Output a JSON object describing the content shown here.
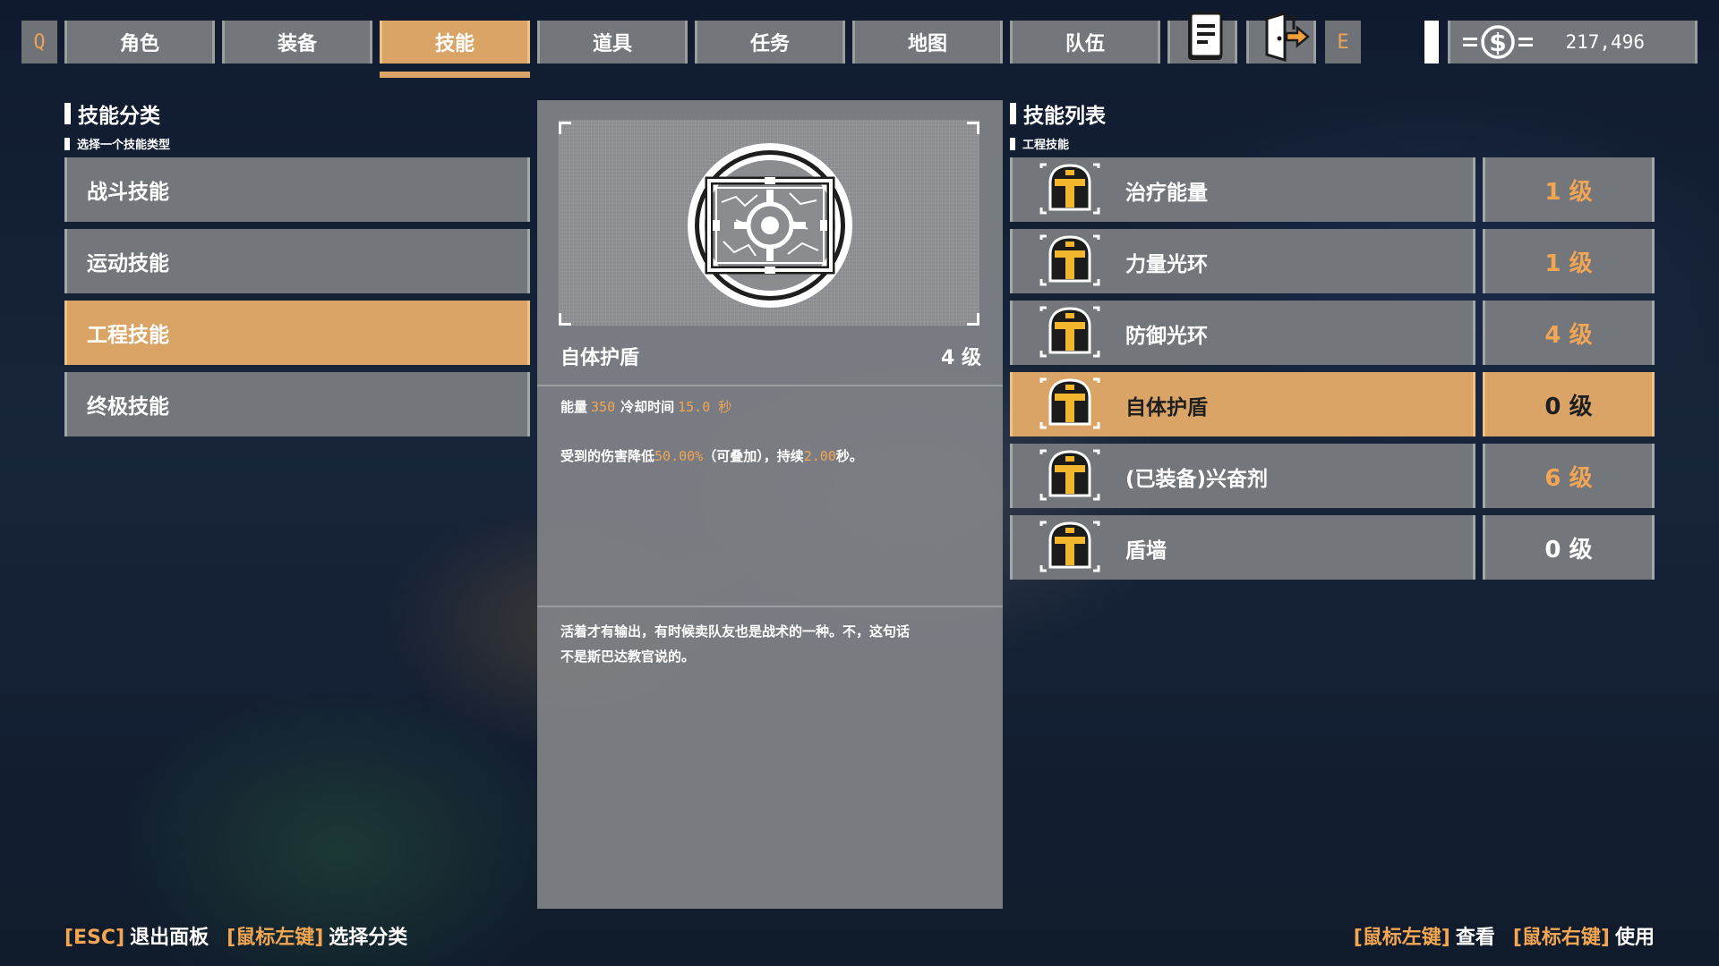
{
  "nav": {
    "left_key": "Q",
    "right_key": "E",
    "tabs": [
      "角色",
      "装备",
      "技能",
      "道具",
      "任务",
      "地图",
      "队伍"
    ],
    "active_tab": "技能",
    "money": "217,496",
    "colors": {
      "accent": "#dba467",
      "highlight_text": "#f2a654",
      "tile": "#73767b"
    },
    "icons": [
      "journal-icon",
      "exit-door-icon",
      "dollar-icon"
    ]
  },
  "categories": {
    "heading": "技能分类",
    "subheading": "选择一个技能类型",
    "items": [
      "战斗技能",
      "运动技能",
      "工程技能",
      "终极技能"
    ],
    "active": "工程技能"
  },
  "detail": {
    "name": "自体护盾",
    "level": "4 级",
    "energy_label": "能量",
    "energy_value": "350",
    "cooldown_label": "冷却时间",
    "cooldown_value": "15.0 秒",
    "effect_prefix": "受到的伤害降低",
    "effect_value1": "50.00%",
    "effect_mid": "（可叠加），持续",
    "effect_value2": "2.00",
    "effect_suffix": "秒。",
    "flavor_line1": "活着才有输出，有时候卖队友也是战术的一种。不，这句话",
    "flavor_line2": "不是斯巴达教官说的。",
    "icon": "shield-emblem-icon"
  },
  "skills": {
    "heading": "技能列表",
    "subheading": "工程技能",
    "items": [
      {
        "name": "治疗能量",
        "level": "1 级",
        "icon": "helmet-icon"
      },
      {
        "name": "力量光环",
        "level": "1 级",
        "icon": "helmet-icon"
      },
      {
        "name": "防御光环",
        "level": "4 级",
        "icon": "helmet-icon"
      },
      {
        "name": "自体护盾",
        "level": "0 级",
        "icon": "helmet-icon"
      },
      {
        "name": "(已装备)兴奋剂",
        "level": "6 级",
        "icon": "helmet-icon"
      },
      {
        "name": "盾墙",
        "level": "0 级",
        "icon": "helmet-icon"
      }
    ],
    "active": "自体护盾"
  },
  "footer": {
    "left": [
      {
        "key": "[ESC]",
        "action": "退出面板"
      },
      {
        "key": "[鼠标左键]",
        "action": "选择分类"
      }
    ],
    "right": [
      {
        "key": "[鼠标左键]",
        "action": "查看"
      },
      {
        "key": "[鼠标右键]",
        "action": "使用"
      }
    ]
  }
}
